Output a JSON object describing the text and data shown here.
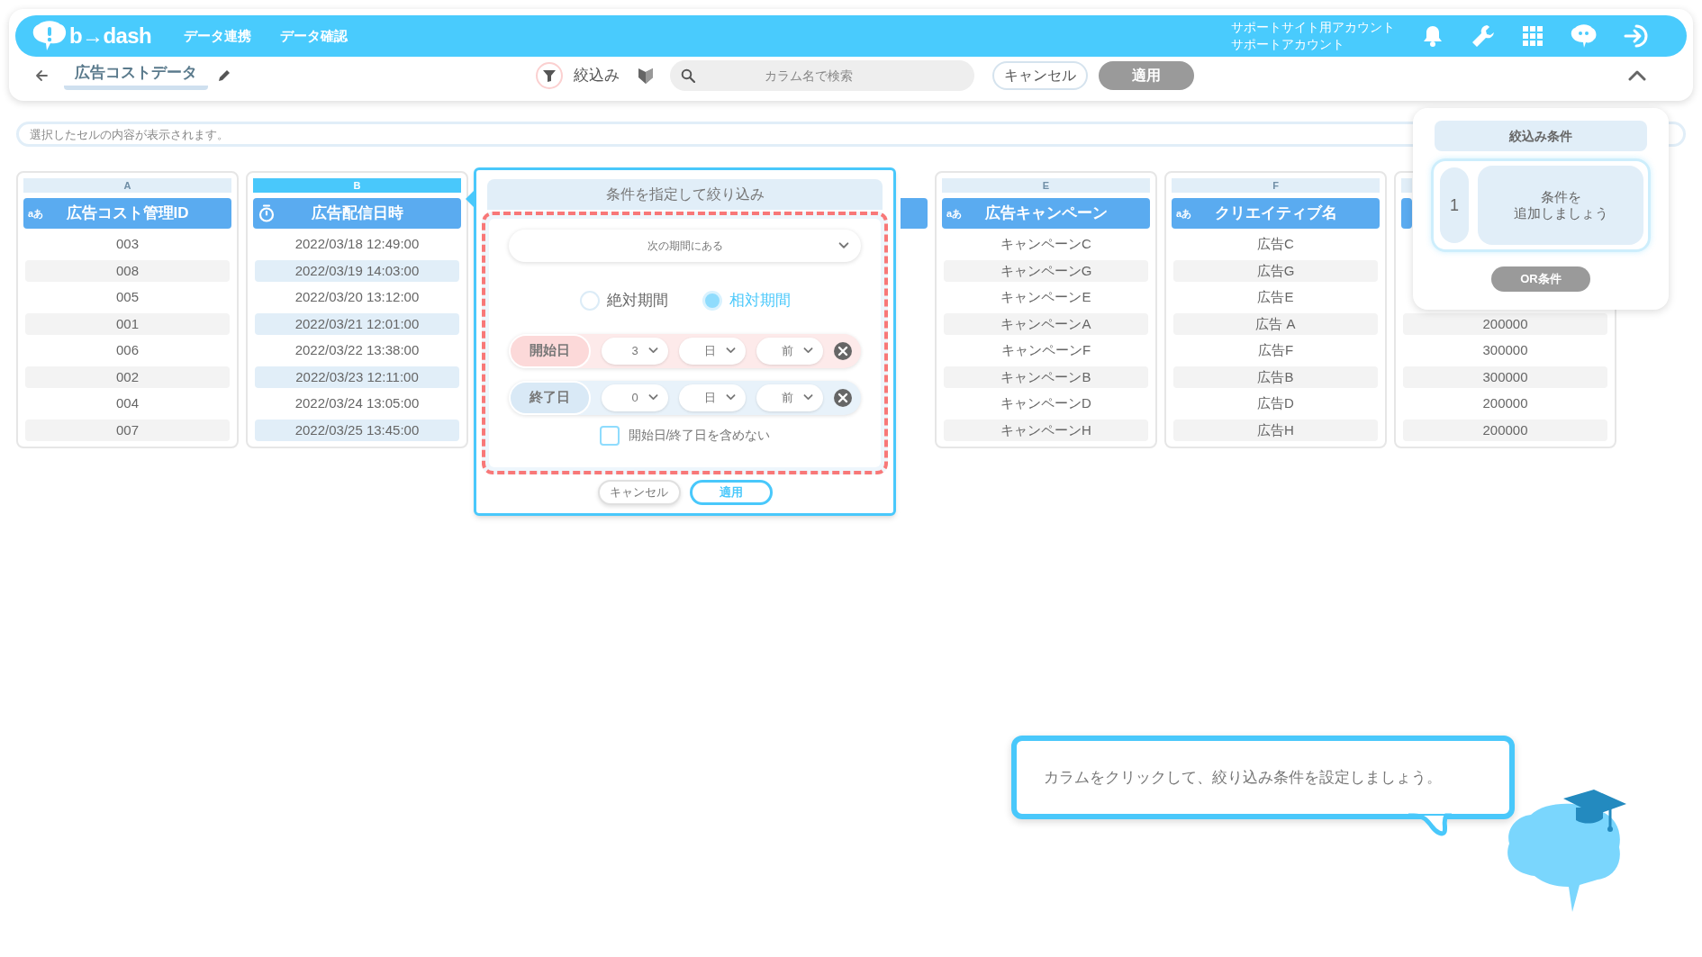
{
  "header": {
    "logo": "b→dash",
    "nav": [
      "データ連携",
      "データ確認"
    ],
    "account": [
      "サポートサイト用アカウント",
      "サポートアカウント"
    ]
  },
  "toolbar": {
    "title": "広告コストデータ",
    "filter_label": "絞込み",
    "search": {
      "placeholder": "カラム名で検索"
    },
    "buttons": [
      {
        "label": "キャンセル",
        "disabled": false
      },
      {
        "label": "適用",
        "disabled": true
      }
    ]
  },
  "cell_bar": {
    "placeholder": "選択したセルの内容が表示されます。"
  },
  "columns": [
    {
      "letter": "A",
      "selected": false,
      "kind": "text",
      "type_label": "aあ",
      "name": "広告コスト管理ID",
      "rows": [
        "003",
        "008",
        "005",
        "001",
        "006",
        "002",
        "004",
        "007"
      ]
    },
    {
      "letter": "B",
      "selected": true,
      "kind": "datetime",
      "name": "広告配信日時",
      "rows": [
        "2022/03/18 12:49:00",
        "2022/03/19 14:03:00",
        "2022/03/20 13:12:00",
        "2022/03/21 12:01:00",
        "2022/03/22 13:38:00",
        "2022/03/23 12:11:00",
        "2022/03/24 13:05:00",
        "2022/03/25 13:45:00"
      ]
    },
    {
      "letter": "E",
      "selected": false,
      "kind": "text",
      "type_label": "aあ",
      "name": "広告キャンペーン",
      "rows": [
        "キャンペーンC",
        "キャンペーンG",
        "キャンペーンE",
        "キャンペーンA",
        "キャンペーンF",
        "キャンペーンB",
        "キャンペーンD",
        "キャンペーンH"
      ]
    },
    {
      "letter": "F",
      "selected": false,
      "kind": "text",
      "type_label": "aあ",
      "name": "クリエイティブ名",
      "rows": [
        "広告C",
        "広告G",
        "広告E",
        "広告 A",
        "広告F",
        "広告B",
        "広告D",
        "広告H"
      ]
    },
    {
      "selected": false,
      "kind": "number",
      "rows": [
        "200000",
        "300000",
        "300000",
        "200000",
        "200000"
      ]
    }
  ],
  "filter_popup": {
    "title": "条件を指定して絞り込み",
    "operator": "次の期間にある",
    "modes": [
      {
        "label": "絶対期間",
        "selected": false
      },
      {
        "label": "相対期間",
        "selected": true
      }
    ],
    "ranges": [
      {
        "kind": "start",
        "label": "開始日",
        "amount": "3",
        "unit": "日",
        "direction": "前"
      },
      {
        "kind": "end",
        "label": "終了日",
        "amount": "0",
        "unit": "日",
        "direction": "前"
      }
    ],
    "exclude": {
      "label": "開始日/終了日を含めない",
      "checked": false
    },
    "buttons": [
      {
        "label": "キャンセル",
        "primary": false
      },
      {
        "label": "適用",
        "primary": true
      }
    ]
  },
  "conditions_panel": {
    "title": "絞込み条件",
    "groups": [
      {
        "number": "1",
        "lines": [
          "条件を",
          "追加しましょう"
        ]
      }
    ],
    "or_button": {
      "label": "OR条件",
      "disabled": true
    }
  },
  "hint": {
    "text": "カラムをクリックして、絞り込み条件を設定しましょう。"
  }
}
